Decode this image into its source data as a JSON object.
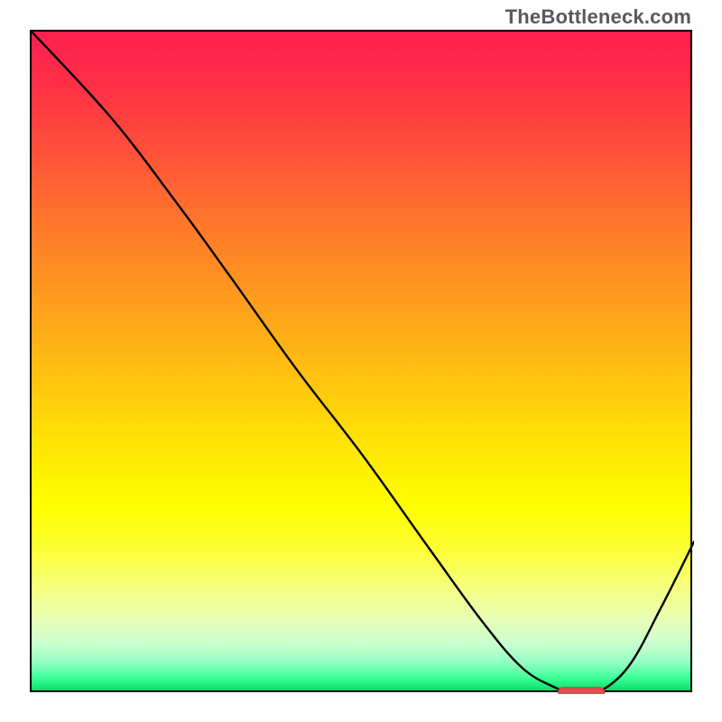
{
  "site_label": "TheBottleneck.com",
  "colors": {
    "curve": "#000000",
    "marker_fill": "#d9534f",
    "marker_stroke": "#b94441",
    "border": "#000000"
  },
  "chart_data": {
    "type": "line",
    "title": "",
    "xlabel": "",
    "ylabel": "",
    "xlim": [
      0,
      100
    ],
    "ylim": [
      0,
      100
    ],
    "grid": false,
    "legend": false,
    "series": [
      {
        "name": "curve",
        "x": [
          0,
          12,
          22,
          30,
          40,
          50,
          60,
          68,
          74,
          79,
          82,
          85,
          90,
          95,
          100
        ],
        "values": [
          100,
          87,
          74,
          63,
          49,
          36,
          22,
          11,
          4,
          1,
          0,
          0,
          4,
          13,
          23
        ]
      }
    ],
    "annotations": [
      {
        "name": "optimal-marker",
        "type": "segment",
        "x_start": 79.5,
        "x_end": 86.5,
        "y": 0.3
      }
    ]
  }
}
